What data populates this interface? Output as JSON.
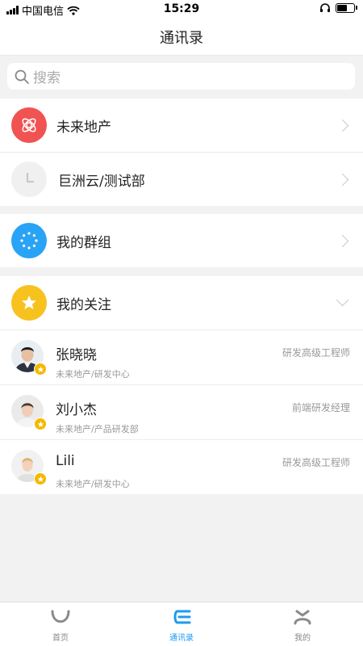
{
  "status_bar": {
    "carrier": "中国电信",
    "time": "15:29"
  },
  "nav": {
    "title": "通讯录"
  },
  "search": {
    "placeholder": "搜索"
  },
  "groups": [
    {
      "label": "未来地产",
      "icon": "atom-icon",
      "color": "#f15352"
    },
    {
      "label": "巨洲云/测试部",
      "icon": "clock-icon",
      "color": "#f2f2f2"
    }
  ],
  "my_groups": {
    "label": "我的群组",
    "icon": "dots-circle-icon",
    "color": "#29a3f5"
  },
  "following": {
    "label": "我的关注",
    "icon": "star-icon",
    "color": "#f7c21d"
  },
  "contacts": [
    {
      "name": "张晓晓",
      "org": "未来地产/研发中心",
      "title": "研发高级工程师"
    },
    {
      "name": "刘小杰",
      "org": "未来地产/产品研发部",
      "title": "前端研发经理"
    },
    {
      "name": "Lili",
      "org": "未来地产/研发中心",
      "title": "研发高级工程师"
    }
  ],
  "tabs": [
    {
      "label": "首页",
      "icon": "home-arc-icon"
    },
    {
      "label": "通讯录",
      "icon": "contacts-c-icon",
      "active": true
    },
    {
      "label": "我的",
      "icon": "profile-icon"
    }
  ],
  "colors": {
    "accent": "#1d9bf0",
    "badge": "#f5b800"
  }
}
